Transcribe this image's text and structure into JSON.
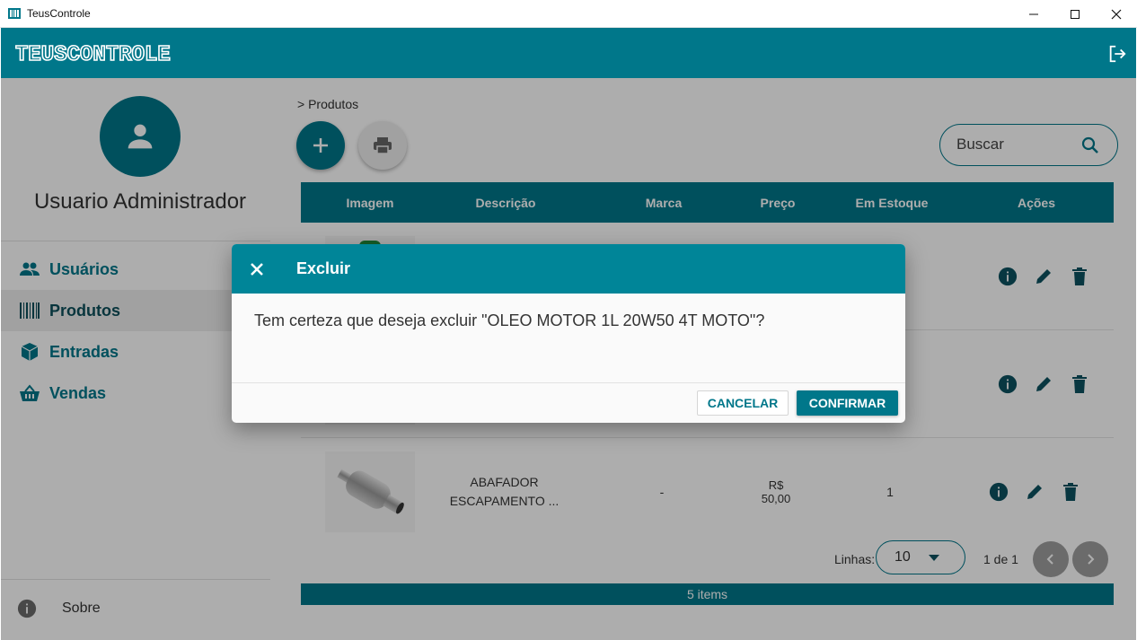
{
  "window": {
    "title": "TeusControle"
  },
  "header": {
    "logo_text": "TEUSCONTROLE"
  },
  "sidebar": {
    "username": "Usuario Administrador",
    "items": [
      {
        "label": "Usuários",
        "icon": "users-icon",
        "active": false
      },
      {
        "label": "Produtos",
        "icon": "barcode-icon",
        "active": true
      },
      {
        "label": "Entradas",
        "icon": "box-icon",
        "active": false
      },
      {
        "label": "Vendas",
        "icon": "basket-icon",
        "active": false
      }
    ],
    "about_label": "Sobre"
  },
  "main": {
    "breadcrumb": "> Produtos",
    "search_placeholder": "Buscar",
    "table": {
      "headers": [
        "Imagem",
        "Descrição",
        "Marca",
        "Preço",
        "Em Estoque",
        "Ações"
      ],
      "visible_row": {
        "description_line1": "ABAFADOR",
        "description_line2": "ESCAPAMENTO ...",
        "brand": "-",
        "price": "R$ 50,00",
        "stock": "1"
      }
    },
    "pagination": {
      "rows_label": "Linhas:",
      "rows_value": "10",
      "pages": "1 de 1",
      "total": "5 items"
    }
  },
  "dialog": {
    "title": "Excluir",
    "message": "Tem certeza que deseja excluir \"OLEO MOTOR 1L 20W50 4T MOTO\"?",
    "cancel_label": "CANCELAR",
    "confirm_label": "CONFIRMAR"
  },
  "colors": {
    "primary": "#00778a",
    "dialog_header": "#008598"
  }
}
